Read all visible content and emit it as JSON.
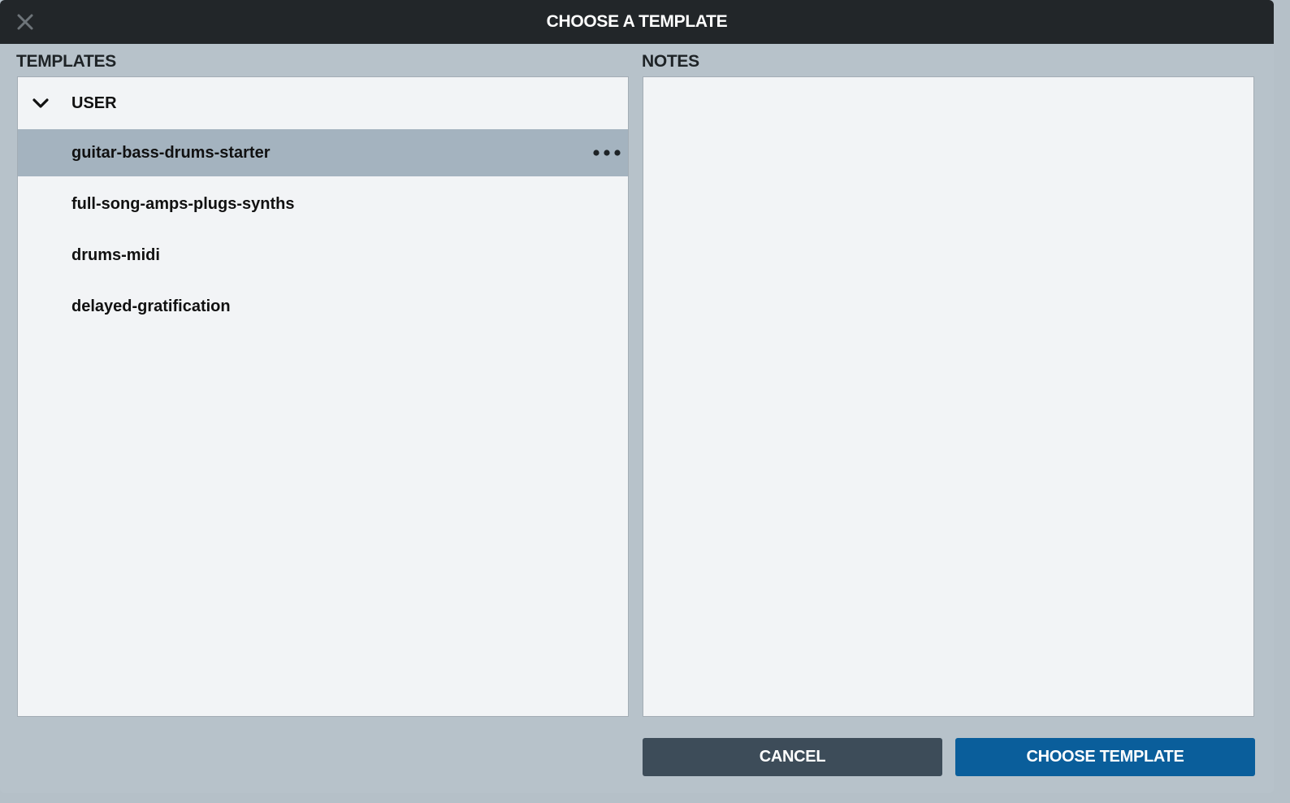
{
  "dialog": {
    "title": "CHOOSE A TEMPLATE",
    "close_icon": "close-icon"
  },
  "templates": {
    "label": "TEMPLATES",
    "group": {
      "label": "USER",
      "expanded": true,
      "icon": "chevron-down-icon"
    },
    "items": [
      {
        "name": "guitar-bass-drums-starter",
        "selected": true
      },
      {
        "name": "full-song-amps-plugs-synths",
        "selected": false
      },
      {
        "name": "drums-midi",
        "selected": false
      },
      {
        "name": "delayed-gratification",
        "selected": false
      }
    ],
    "more_icon": "more-horizontal-icon"
  },
  "notes": {
    "label": "NOTES",
    "content": ""
  },
  "buttons": {
    "cancel": "CANCEL",
    "choose": "CHOOSE TEMPLATE"
  },
  "colors": {
    "titlebar": "#222629",
    "background": "#b7c2ca",
    "panel": "#f2f4f6",
    "selected_row": "#a4b3bf",
    "cancel_button": "#3d4c59",
    "primary_button": "#0a5e9b"
  }
}
